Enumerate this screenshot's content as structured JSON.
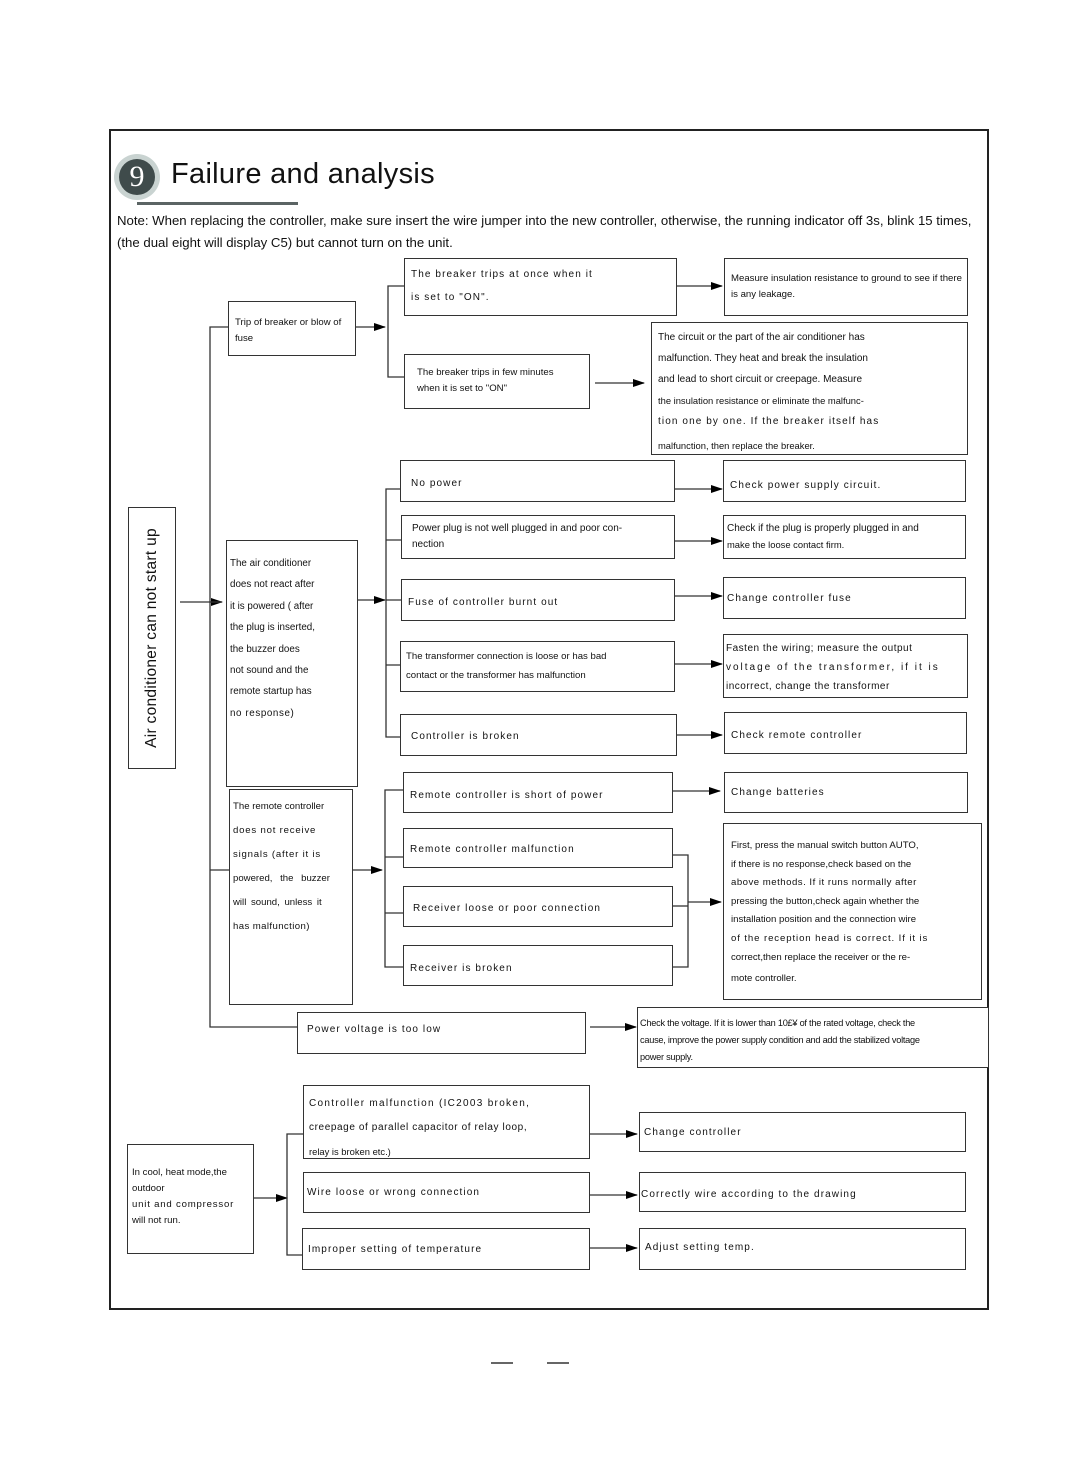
{
  "header": {
    "section_number": "9",
    "title": "Failure and analysis",
    "note": "Note: When replacing the controller, make sure insert the wire jumper into the new controller, otherwise,  the running indicator off 3s, blink 15 times, (the dual eight will display C5) but cannot turn on the unit."
  },
  "root": {
    "label": "Air conditioner can not start up"
  },
  "breaker": {
    "symptom": "Trip of breaker or blow of fuse",
    "causes": [
      {
        "label": "The breaker trips at once when it is set to \"ON\".",
        "line1": "The breaker trips at once when it",
        "line2": "is set to \"ON\".",
        "solution": "Measure insulation resistance to ground to see if there is any leakage."
      },
      {
        "label": "The breaker trips in few minutes when it is set to \"ON\"",
        "line1": "The breaker trips in few minutes",
        "line2": "when it is set to \"ON\"",
        "solution_lines": [
          "The circuit or the part of the air conditioner has",
          "malfunction. They heat and break the insulation",
          "and lead to short circuit or creepage. Measure",
          "the insulation resistance or eliminate the malfunc-",
          "tion one by one. If the breaker itself has",
          "malfunction, then replace the breaker."
        ]
      }
    ]
  },
  "no_react": {
    "symptom_lines": [
      "The air conditioner",
      "does not react after",
      "it is powered ( after",
      "the plug is inserted,",
      "the buzzer does",
      "not sound and the",
      "remote startup has",
      "no response)"
    ],
    "causes": [
      {
        "cause": "No power",
        "solution": "Check power supply circuit."
      },
      {
        "cause_lines": [
          "Power plug is not well plugged in and poor con-",
          "nection"
        ],
        "solution_lines": [
          "Check if the plug is properly plugged in and",
          "make the loose contact firm."
        ]
      },
      {
        "cause": "Fuse of controller burnt out",
        "solution": "Change controller fuse"
      },
      {
        "cause_lines": [
          "The transformer connection is loose or has bad",
          "contact or the transformer has malfunction"
        ],
        "solution_lines": [
          "Fasten the wiring; measure the output",
          "voltage of the transformer, if it is",
          "incorrect, change the transformer"
        ]
      },
      {
        "cause": "Controller is broken",
        "solution": "Check remote controller"
      }
    ]
  },
  "remote": {
    "symptom_lines": [
      "The remote controller",
      "does not receive",
      "signals (after it is",
      "powered, the buzzer",
      "will sound, unless it",
      "has  malfunction)"
    ],
    "causes": [
      {
        "cause": "Remote controller is short of power",
        "solution": "Change batteries"
      },
      {
        "cause": "Remote controller malfunction"
      },
      {
        "cause": "Receiver loose or poor connection"
      },
      {
        "cause": "Receiver is broken"
      }
    ],
    "shared_solution_lines": [
      "First, press the manual switch button AUTO,",
      "if there is no response,check based on the",
      "above methods. If it runs normally after",
      "pressing the button,check again whether the",
      "installation position and the connection wire",
      "of the reception head is correct. If it is",
      "correct,then replace the receiver or the re-",
      "mote controller."
    ]
  },
  "voltage": {
    "cause": "Power voltage is too low",
    "solution_lines": [
      "Check the voltage. If it is lower than 10£¥ of the rated voltage, check the",
      "cause, improve the power supply condition and add the stabilized voltage",
      "power supply."
    ]
  },
  "outdoor": {
    "symptom_lines": [
      "In cool, heat mode,the",
      "outdoor",
      "unit and compressor",
      "will not run."
    ],
    "causes": [
      {
        "cause_lines": [
          "Controller  malfunction  (IC2003  broken,",
          "creepage of   parallel capacitor of relay loop,",
          "relay is broken etc.)"
        ],
        "solution": "Change controller"
      },
      {
        "cause": "Wire loose or wrong connection",
        "solution": "Correctly wire according to the drawing"
      },
      {
        "cause": "Improper setting of temperature",
        "solution": "Adjust setting temp."
      }
    ]
  }
}
